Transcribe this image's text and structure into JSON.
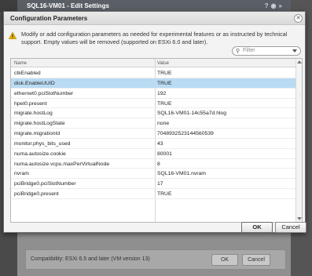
{
  "background_window": {
    "title": "SQL16-VM01 - Edit Settings",
    "compatibility": "Compatibility: ESXi 6.5 and later (VM version 13)",
    "ok_label": "OK",
    "cancel_label": "Cancel"
  },
  "dialog": {
    "title": "Configuration Parameters",
    "warning": "Modify or add configuration parameters as needed for experimental features or as instructed by technical support. Empty values will be removed (supported on ESXi 6.0 and later).",
    "filter_placeholder": "Filter",
    "columns": {
      "name": "Name",
      "value": "Value"
    },
    "rows": [
      {
        "name": "ctkEnabled",
        "value": "TRUE",
        "selected": false
      },
      {
        "name": "disk.EnableUUID",
        "value": "TRUE",
        "selected": true
      },
      {
        "name": "ethernet0.pciSlotNumber",
        "value": "192",
        "selected": false
      },
      {
        "name": "hpet0.present",
        "value": "TRUE",
        "selected": false
      },
      {
        "name": "migrate.hostLog",
        "value": "SQL16-VM01-14c55a7d.hlog",
        "selected": false
      },
      {
        "name": "migrate.hostLogState",
        "value": "none",
        "selected": false
      },
      {
        "name": "migrate.migrationId",
        "value": "7048932523144560539",
        "selected": false
      },
      {
        "name": "monitor.phys_bits_used",
        "value": "43",
        "selected": false
      },
      {
        "name": "numa.autosize.cookie",
        "value": "80001",
        "selected": false
      },
      {
        "name": "numa.autosize.vcpu.maxPerVirtualNode",
        "value": "8",
        "selected": false
      },
      {
        "name": "nvram",
        "value": "SQL16-VM01.nvram",
        "selected": false
      },
      {
        "name": "pciBridge0.pciSlotNumber",
        "value": "17",
        "selected": false
      },
      {
        "name": "pciBridge0.present",
        "value": "TRUE",
        "selected": false
      }
    ],
    "ok_label": "OK",
    "cancel_label": "Cancel"
  },
  "colors": {
    "selected_row": "#b9dbf3",
    "warning_icon": "#e8b400"
  }
}
